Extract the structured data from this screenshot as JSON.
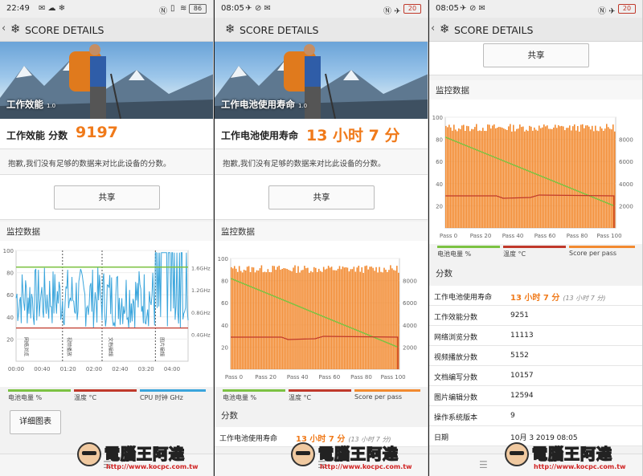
{
  "panels": [
    {
      "status": {
        "time": "22:49",
        "battery": "86"
      },
      "title": "SCORE DETAILS",
      "hero": {
        "label": "工作效能",
        "version": "1.0"
      },
      "score": {
        "label": "工作效能 分数",
        "value": "9197"
      },
      "note": "抱歉,我们没有足够的数据来对比此设备的分数。",
      "share": "共享",
      "monitor_title": "监控数据",
      "legend": [
        "电池电量 %",
        "温度 °C",
        "CPU 时钟 GHz"
      ],
      "detail_button": "详细图表"
    },
    {
      "status": {
        "time": "08:05",
        "battery": "20"
      },
      "title": "SCORE DETAILS",
      "hero": {
        "label": "工作电池使用寿命",
        "version": "1.0"
      },
      "score": {
        "label": "工作电池使用寿命",
        "value": "13 小时 7 分"
      },
      "note": "抱歉,我们没有足够的数据来对比此设备的分数。",
      "share": "共享",
      "monitor_title": "监控数据",
      "legend": [
        "电池电量 %",
        "温度 °C",
        "Score per pass"
      ],
      "scores_title": "分数",
      "first_row": {
        "k": "工作电池使用寿命",
        "v": "13 小时 7 分",
        "sub": "(13 小时 7 分)"
      }
    },
    {
      "status": {
        "time": "08:05",
        "battery": "20"
      },
      "title": "SCORE DETAILS",
      "share": "共享",
      "monitor_title": "监控数据",
      "legend": [
        "电池电量 %",
        "温度 °C",
        "Score per pass"
      ],
      "scores_title": "分数",
      "rows": [
        {
          "k": "工作电池使用寿命",
          "v": "13 小时 7 分",
          "sub": "(13 小时 7 分)"
        },
        {
          "k": "工作效能分数",
          "v": "9251"
        },
        {
          "k": "网络浏览分数",
          "v": "11113"
        },
        {
          "k": "视频播放分数",
          "v": "5152"
        },
        {
          "k": "文档编写分数",
          "v": "10157"
        },
        {
          "k": "图片编辑分数",
          "v": "12594"
        },
        {
          "k": "操作系统版本",
          "v": "9"
        },
        {
          "k": "日期",
          "v": "10月 3 2019 08:05"
        }
      ]
    }
  ],
  "chart_data": [
    {
      "type": "line",
      "x_ticks": [
        "00:00",
        "00:40",
        "01:20",
        "02:00",
        "02:40",
        "03:20",
        "04:00"
      ],
      "y_left_ticks": [
        20,
        40,
        60,
        80,
        100
      ],
      "y_right_ticks": [
        "0.4GHz",
        "0.8GHz",
        "1.2GHz",
        "1.6GHz"
      ],
      "annotations": [
        "网络浏览",
        "视频播放",
        "文档编辑",
        "图片编辑"
      ],
      "series": [
        {
          "name": "电池电量 %",
          "color": "#7cc242",
          "values": [
            85,
            85
          ]
        },
        {
          "name": "温度 °C",
          "color": "#c0392b",
          "values": [
            30,
            30
          ]
        },
        {
          "name": "CPU 时钟 GHz",
          "color": "#3aa5dc"
        }
      ]
    },
    {
      "type": "bar",
      "x_ticks": [
        "Pass 0",
        "Pass 20",
        "Pass 40",
        "Pass 60",
        "Pass 80",
        "Pass 100"
      ],
      "y_left_ticks": [
        20,
        40,
        60,
        80,
        100
      ],
      "y_right_ticks": [
        2000,
        4000,
        6000,
        8000
      ],
      "passes": 106,
      "bar_range": [
        8700,
        9400
      ],
      "series": [
        {
          "name": "电池电量 %",
          "color": "#7cc242",
          "values": [
            82,
            20
          ]
        },
        {
          "name": "温度 °C",
          "color": "#c0392b",
          "values": [
            29,
            29
          ]
        },
        {
          "name": "Score per pass",
          "color": "#f28a30"
        }
      ]
    },
    {
      "type": "bar",
      "x_ticks": [
        "Pass 0",
        "Pass 20",
        "Pass 40",
        "Pass 60",
        "Pass 80",
        "Pass 100"
      ],
      "y_left_ticks": [
        20,
        40,
        60,
        80,
        100
      ],
      "y_right_ticks": [
        2000,
        4000,
        6000,
        8000
      ],
      "passes": 106,
      "bar_range": [
        8700,
        9400
      ],
      "series": [
        {
          "name": "电池电量 %",
          "color": "#7cc242",
          "values": [
            82,
            20
          ]
        },
        {
          "name": "温度 °C",
          "color": "#c0392b",
          "values": [
            29,
            29
          ]
        },
        {
          "name": "Score per pass",
          "color": "#f28a30"
        }
      ]
    }
  ],
  "watermark": {
    "text": "電腦王阿達",
    "url": "http://www.kocpc.com.tw"
  }
}
